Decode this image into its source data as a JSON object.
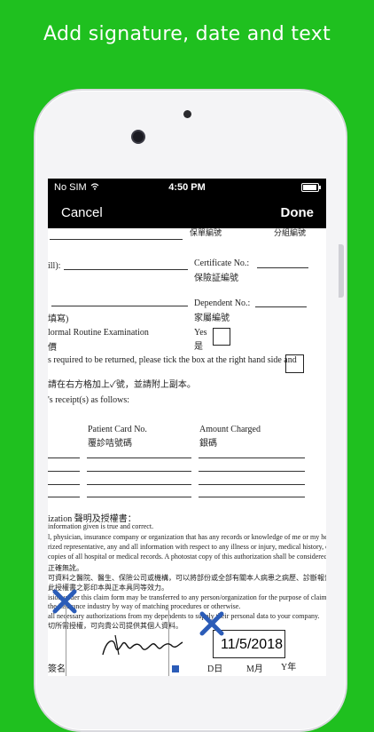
{
  "headline": "Add signature, date and text",
  "status": {
    "carrier": "No SIM",
    "time": "4:50 PM"
  },
  "nav": {
    "cancel": "Cancel",
    "done": "Done"
  },
  "doc": {
    "top_label": "保單編號",
    "top_label2": "分組編號",
    "ill": "ill):",
    "certificate": "Certificate No.:",
    "certificate_zh": "保險証編號",
    "dependent": "Dependent No.:",
    "dependent_zh": "家屬編號",
    "fill_zh": "填寫)",
    "routine": "lormal Routine Examination",
    "routine_zh": "價",
    "yes": "Yes",
    "yes_zh": "是",
    "returned": "s required to be returned, please tick the box at the right hand side and",
    "returned_zh": "請在右方格加上✓號，並請附上副本。",
    "receipt": "'s receipt(s) as follows:",
    "patient_card": "Patient Card No.",
    "patient_card_zh": "覆診咭號碼",
    "amount": "Amount Charged",
    "amount_zh": "銀碼",
    "auth": "ization  聲明及授權書：",
    "auth_line1": "information given is true and correct.",
    "auth_line2": "l, physician, insurance company or organization that has any records or knowledge of me or my health, to",
    "auth_line3": "rized representative, any and all information with respect to any illness or injury, medical history, consultation",
    "auth_line4": "copies of all hospital or medical records. A photostat copy of this authorization shall be considered as effective",
    "auth_zh1": "正確無訛。",
    "auth_zh2": "可資料之醫院、醫生、保險公司或機構，可以將部份或全部有關本人病患之病歷、診斷報告及第方等資料",
    "auth_zh3": "此授權書之影印本與正本具同等效力。",
    "auth_line5": "ision under this claim form may be transferred to any person/organization for the purpose of claim",
    "auth_line6": "the insurance industry by way of matching procedures or otherwise.",
    "auth_line7": "all necessary authorizations from my dependents to supply their personal data to your company.",
    "auth_zh4": "切所需授權，可向貴公司提供其個人資料。",
    "sign_zh": "簽名",
    "date_day": "D日",
    "date_month": "M月",
    "date_year": "Y年"
  },
  "date_stamp": "11/5/2018",
  "colors": {
    "background": "#1fc01f",
    "xmark": "#2b5cb8"
  }
}
